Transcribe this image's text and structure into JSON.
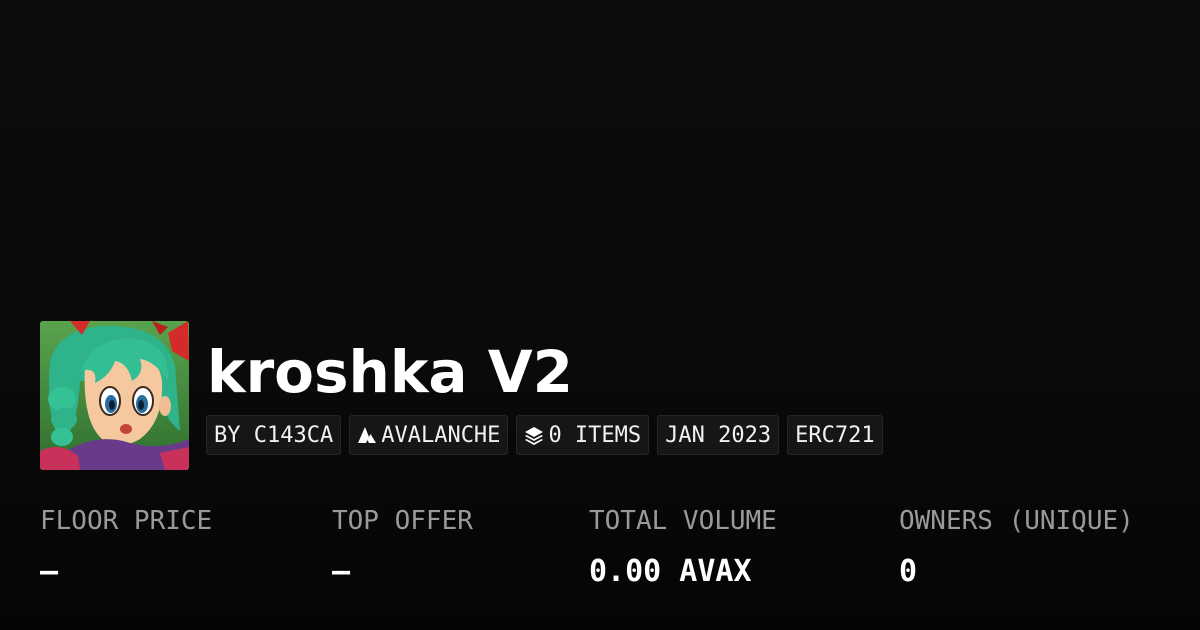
{
  "collection": {
    "name": "kroshka V2",
    "avatar_icon": "character-portrait-image"
  },
  "tags": {
    "creator": "BY C143CA",
    "chain": "AVALANCHE",
    "chain_icon": "avalanche-icon",
    "items": "0 ITEMS",
    "items_icon": "layers-icon",
    "date": "JAN 2023",
    "standard": "ERC721"
  },
  "stats": {
    "floor_price": {
      "label": "FLOOR PRICE",
      "value": "–"
    },
    "top_offer": {
      "label": "TOP OFFER",
      "value": "–"
    },
    "total_volume": {
      "label": "TOTAL VOLUME",
      "value": "0.00 AVAX"
    },
    "owners": {
      "label": "OWNERS (UNIQUE)",
      "value": "0"
    }
  },
  "colors": {
    "background": "#0a0a0a",
    "tag_background": "#161616",
    "label_gray": "#9a9a9a",
    "text_white": "#ffffff"
  }
}
